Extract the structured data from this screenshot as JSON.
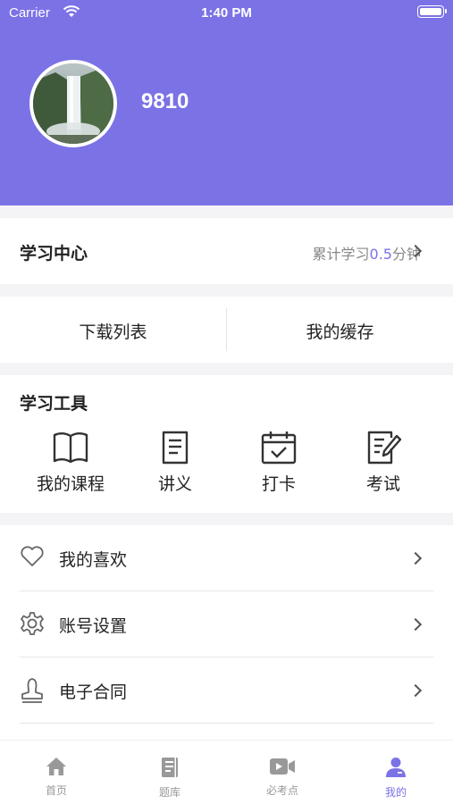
{
  "status_bar": {
    "carrier": "Carrier",
    "time": "1:40 PM"
  },
  "profile": {
    "username": "9810"
  },
  "study_center": {
    "title": "学习中心",
    "summary_prefix": "累计学习",
    "summary_value": "0.5",
    "summary_suffix": "分钟"
  },
  "downloads": {
    "download_list": "下载列表",
    "my_cache": "我的缓存"
  },
  "tools": {
    "title": "学习工具",
    "items": [
      {
        "label": "我的课程",
        "icon": "book-icon"
      },
      {
        "label": "讲义",
        "icon": "document-icon"
      },
      {
        "label": "打卡",
        "icon": "calendar-check-icon"
      },
      {
        "label": "考试",
        "icon": "exam-edit-icon"
      }
    ]
  },
  "menu": {
    "items": [
      {
        "label": "我的喜欢",
        "icon": "heart-icon"
      },
      {
        "label": "账号设置",
        "icon": "gear-icon"
      },
      {
        "label": "电子合同",
        "icon": "stamp-icon"
      }
    ]
  },
  "tabbar": {
    "items": [
      {
        "label": "首页",
        "icon": "home-icon",
        "active": false
      },
      {
        "label": "题库",
        "icon": "question-bank-icon",
        "active": false
      },
      {
        "label": "必考点",
        "icon": "video-icon",
        "active": false
      },
      {
        "label": "我的",
        "icon": "user-icon",
        "active": true
      }
    ]
  },
  "colors": {
    "accent": "#7b72e6",
    "background": "#f4f4f6",
    "inactive": "#999999"
  }
}
